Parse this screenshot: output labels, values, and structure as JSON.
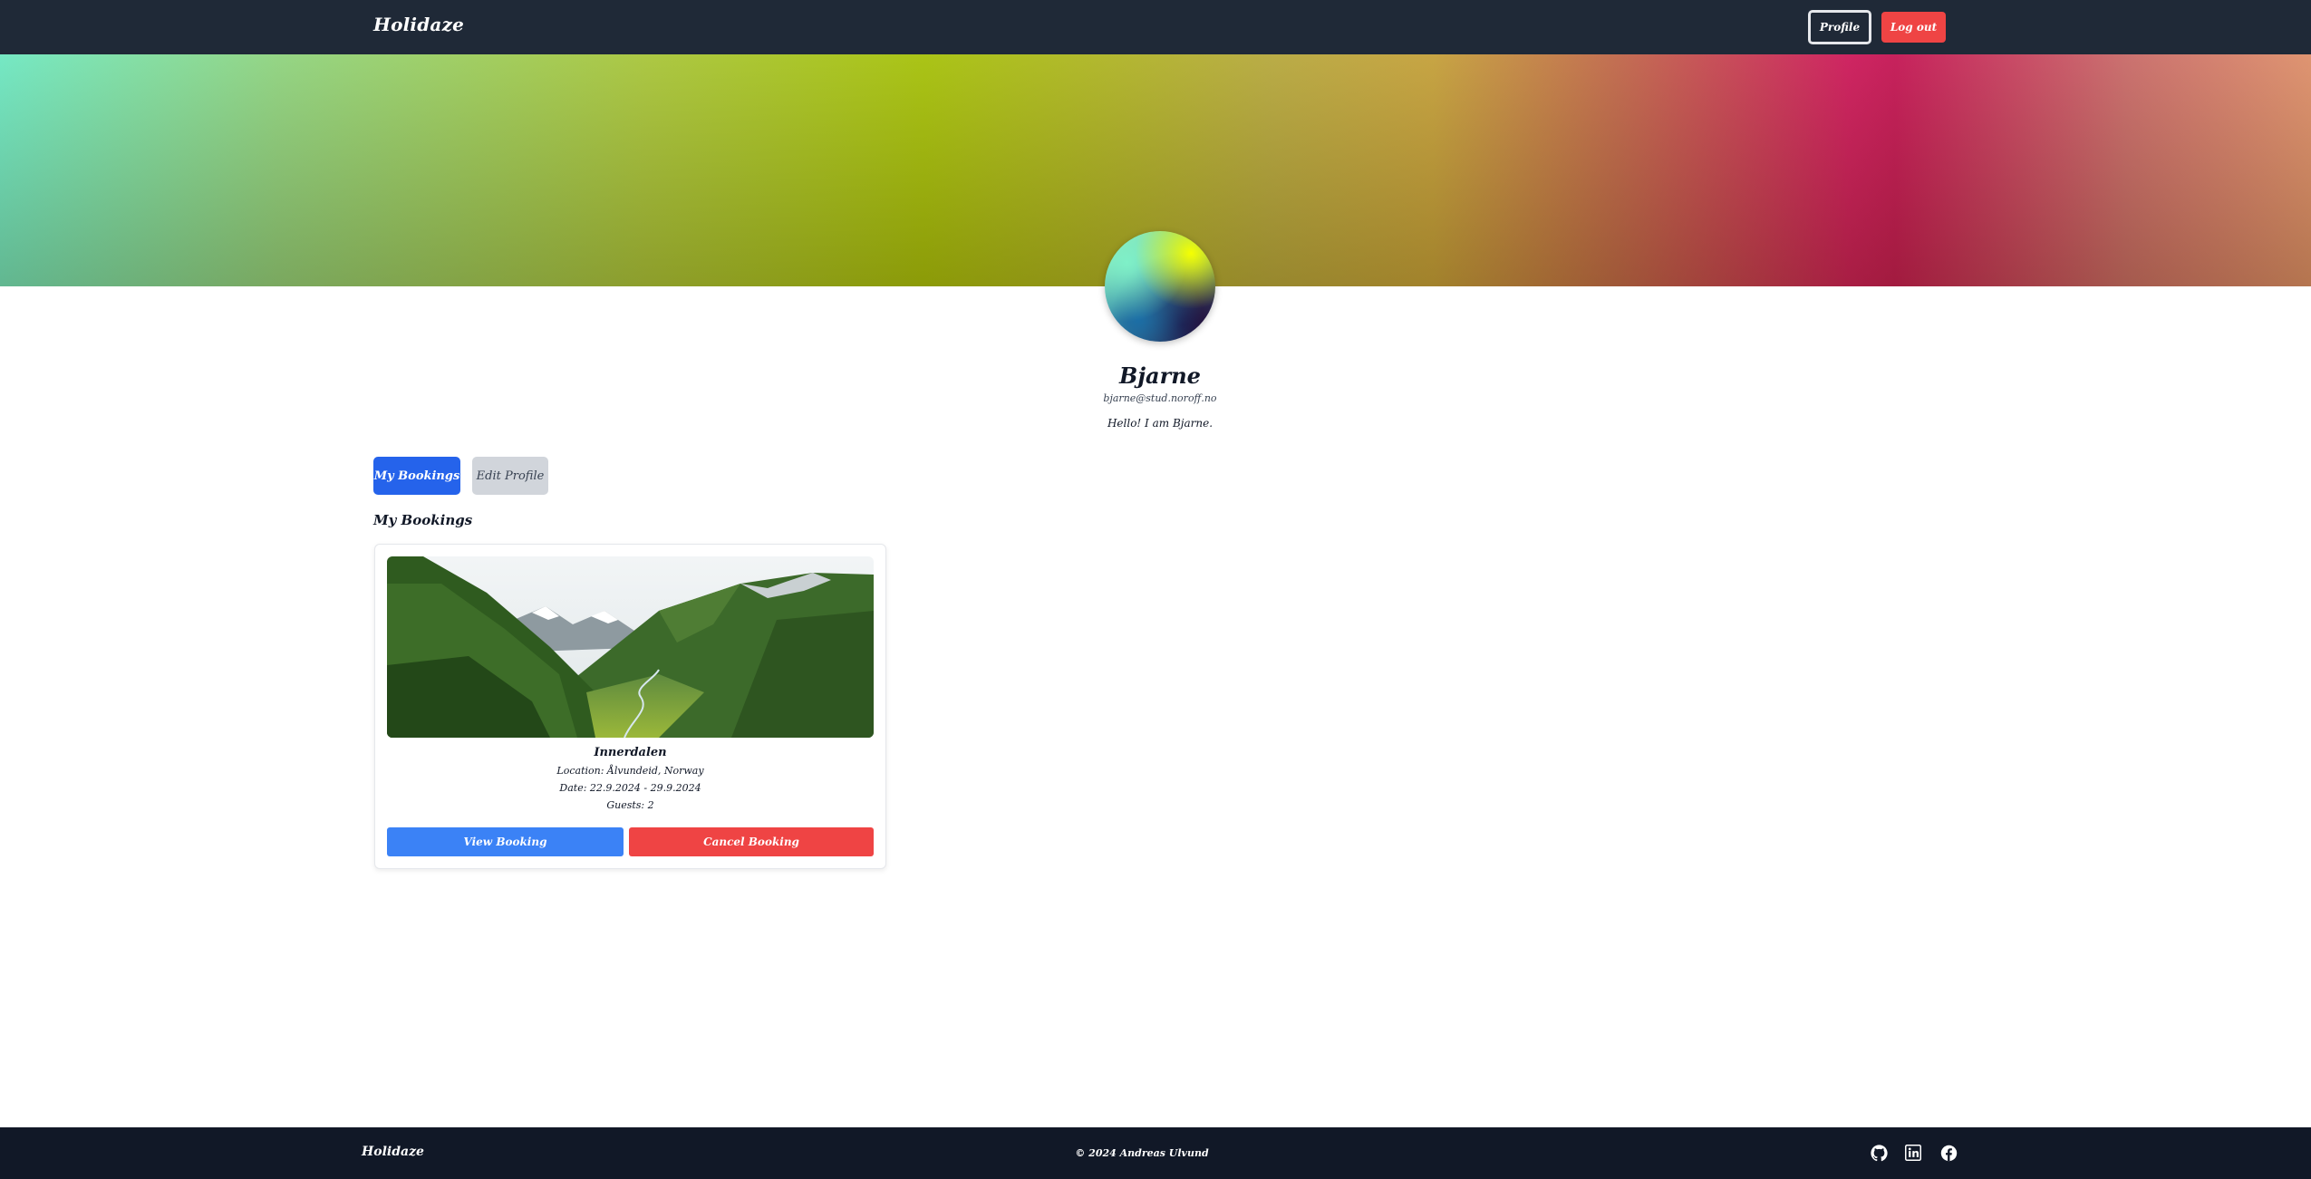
{
  "header": {
    "brand": "Holidaze",
    "profile_label": "Profile",
    "logout_label": "Log out"
  },
  "profile": {
    "name": "Bjarne",
    "email": "bjarne@stud.noroff.no",
    "bio": "Hello! I am Bjarne."
  },
  "tabs": {
    "bookings_label": "My Bookings",
    "edit_label": "Edit Profile"
  },
  "bookings_section": {
    "title": "My Bookings",
    "items": [
      {
        "name": "Innerdalen",
        "location": "Location: Ålvundeid, Norway",
        "date": "Date: 22.9.2024 - 29.9.2024",
        "guests": "Guests: 2",
        "view_label": "View Booking",
        "cancel_label": "Cancel Booking"
      }
    ]
  },
  "footer": {
    "brand": "Holidaze",
    "copyright": "© 2024 Andreas Ulvund",
    "social_icons": [
      "github-icon",
      "linkedin-icon",
      "facebook-icon"
    ]
  },
  "colors": {
    "header_bg": "#1f2937",
    "footer_bg": "#111827",
    "primary": "#2563eb",
    "view_button": "#3b82f6",
    "danger": "#ef4444",
    "tab_inactive": "#d1d5db"
  }
}
